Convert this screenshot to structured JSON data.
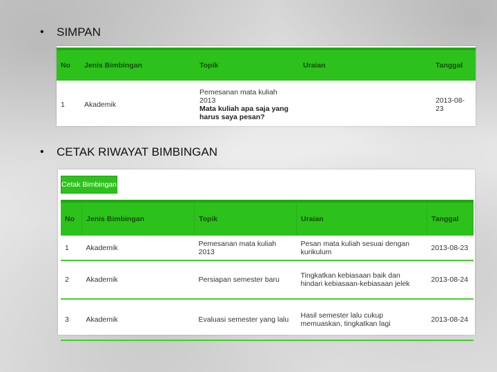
{
  "bullets": {
    "simpan": "SIMPAN",
    "cetak": "CETAK RIWAYAT BIMBINGAN",
    "bullet_char": "•"
  },
  "headers": {
    "no": "No",
    "jenis": "Jenis Bimbingan",
    "topik": "Topik",
    "uraian": "Uraian",
    "tanggal": "Tanggal"
  },
  "simpan_table": {
    "row": {
      "no": "1",
      "jenis": "Akademik",
      "topik_line1": "Pemesanan mata kuliah 2013",
      "topik_line2": "Mata kuliah apa saja yang harus saya pesan?",
      "uraian": "",
      "tanggal": "2013-08-23"
    }
  },
  "cetak_button": "Cetak Bimbingan",
  "cetak_table": {
    "rows": [
      {
        "no": "1",
        "jenis": "Akademik",
        "topik": "Pemesanan mata kuliah 2013",
        "uraian": "Pesan mata kuliah sesuai dengan kurikulum",
        "tanggal": "2013-08-23"
      },
      {
        "no": "2",
        "jenis": "Akademik",
        "topik": "Persiapan semester baru",
        "uraian": "Tingkatkan kebiasaan baik dan hindari kebiasaan-kebiasaan jelek",
        "tanggal": "2013-08-24"
      },
      {
        "no": "3",
        "jenis": "Akademik",
        "topik": "Evaluasi semester yang lalu",
        "uraian": "Hasil semester lalu cukup memuaskan, tingkatkan lagi",
        "tanggal": "2013-08-24"
      }
    ]
  },
  "colors": {
    "header_green": "#2dc21b",
    "row_line_green": "#3fd02a"
  }
}
